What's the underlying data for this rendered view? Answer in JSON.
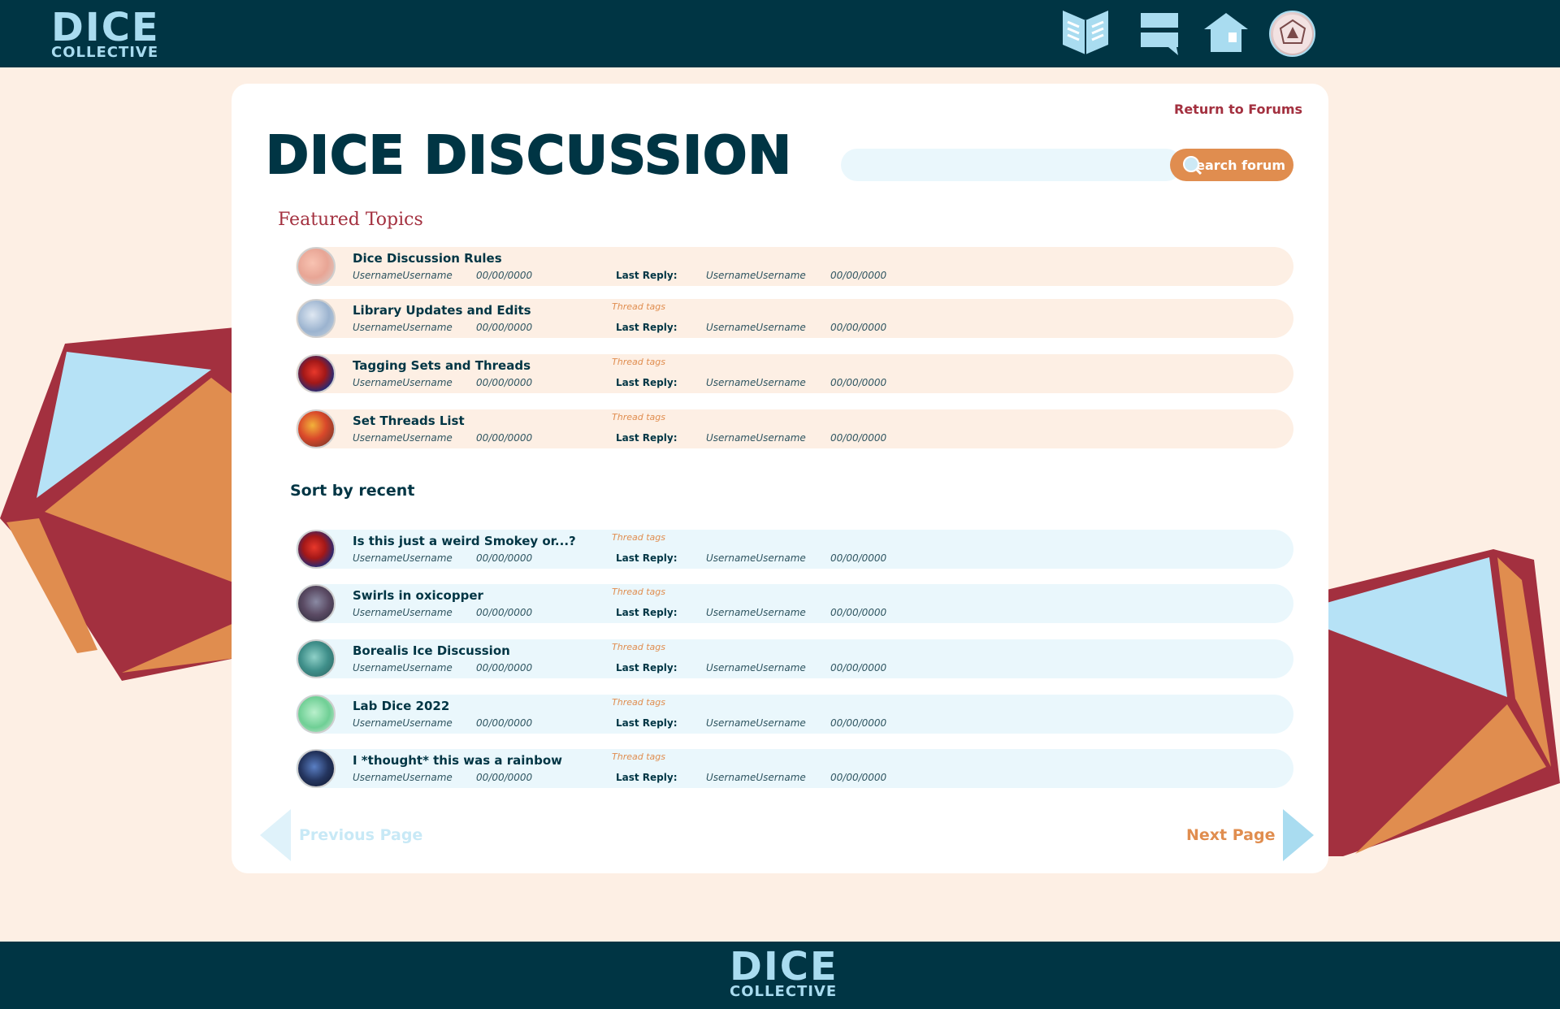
{
  "header": {
    "logo_big": "DICE",
    "logo_small": "COLLECTIVE",
    "nav_icons": [
      "library-icon",
      "forum-icon",
      "home-icon",
      "user-avatar"
    ]
  },
  "footer": {
    "logo_big": "DICE",
    "logo_small": "COLLECTIVE"
  },
  "page": {
    "return_link": "Return to Forums",
    "title": "DICE DISCUSSION",
    "search_placeholder": "",
    "search_button": "search forum"
  },
  "featured": {
    "heading": "Featured Topics",
    "items": [
      {
        "title": "Dice Discussion Rules",
        "author": "UsernameUsername",
        "date": "00/00/0000",
        "tags": "",
        "last_reply_label": "Last Reply:",
        "last_reply_user": "UsernameUsername",
        "last_reply_date": "00/00/0000"
      },
      {
        "title": "Library Updates and Edits",
        "author": "UsernameUsername",
        "date": "00/00/0000",
        "tags": "Thread tags",
        "last_reply_label": "Last Reply:",
        "last_reply_user": "UsernameUsername",
        "last_reply_date": "00/00/0000"
      },
      {
        "title": "Tagging Sets and Threads",
        "author": "UsernameUsername",
        "date": "00/00/0000",
        "tags": "Thread tags",
        "last_reply_label": "Last Reply:",
        "last_reply_user": "UsernameUsername",
        "last_reply_date": "00/00/0000"
      },
      {
        "title": "Set Threads List",
        "author": "UsernameUsername",
        "date": "00/00/0000",
        "tags": "Thread tags",
        "last_reply_label": "Last Reply:",
        "last_reply_user": "UsernameUsername",
        "last_reply_date": "00/00/0000"
      }
    ]
  },
  "recent": {
    "heading": "Sort by recent",
    "items": [
      {
        "title": "Is this just a weird Smokey or...?",
        "author": "UsernameUsername",
        "date": "00/00/0000",
        "tags": "Thread tags",
        "last_reply_label": "Last Reply:",
        "last_reply_user": "UsernameUsername",
        "last_reply_date": "00/00/0000"
      },
      {
        "title": "Swirls in oxicopper",
        "author": "UsernameUsername",
        "date": "00/00/0000",
        "tags": "Thread tags",
        "last_reply_label": "Last Reply:",
        "last_reply_user": "UsernameUsername",
        "last_reply_date": "00/00/0000"
      },
      {
        "title": "Borealis Ice Discussion",
        "author": "UsernameUsername",
        "date": "00/00/0000",
        "tags": "Thread tags",
        "last_reply_label": "Last Reply:",
        "last_reply_user": "UsernameUsername",
        "last_reply_date": "00/00/0000"
      },
      {
        "title": "Lab Dice 2022",
        "author": "UsernameUsername",
        "date": "00/00/0000",
        "tags": "Thread tags",
        "last_reply_label": "Last Reply:",
        "last_reply_user": "UsernameUsername",
        "last_reply_date": "00/00/0000"
      },
      {
        "title": "I *thought* this was a rainbow",
        "author": "UsernameUsername",
        "date": "00/00/0000",
        "tags": "Thread tags",
        "last_reply_label": "Last Reply:",
        "last_reply_user": "UsernameUsername",
        "last_reply_date": "00/00/0000"
      }
    ]
  },
  "pagination": {
    "prev_label": "Previous Page",
    "next_label": "Next Page"
  },
  "colors": {
    "navy": "#003544",
    "light_blue": "#a9dcf0",
    "peach_bg": "#fdefe4",
    "crimson": "#a3303f",
    "orange": "#e08d4f",
    "ice": "#eaf7fc"
  }
}
